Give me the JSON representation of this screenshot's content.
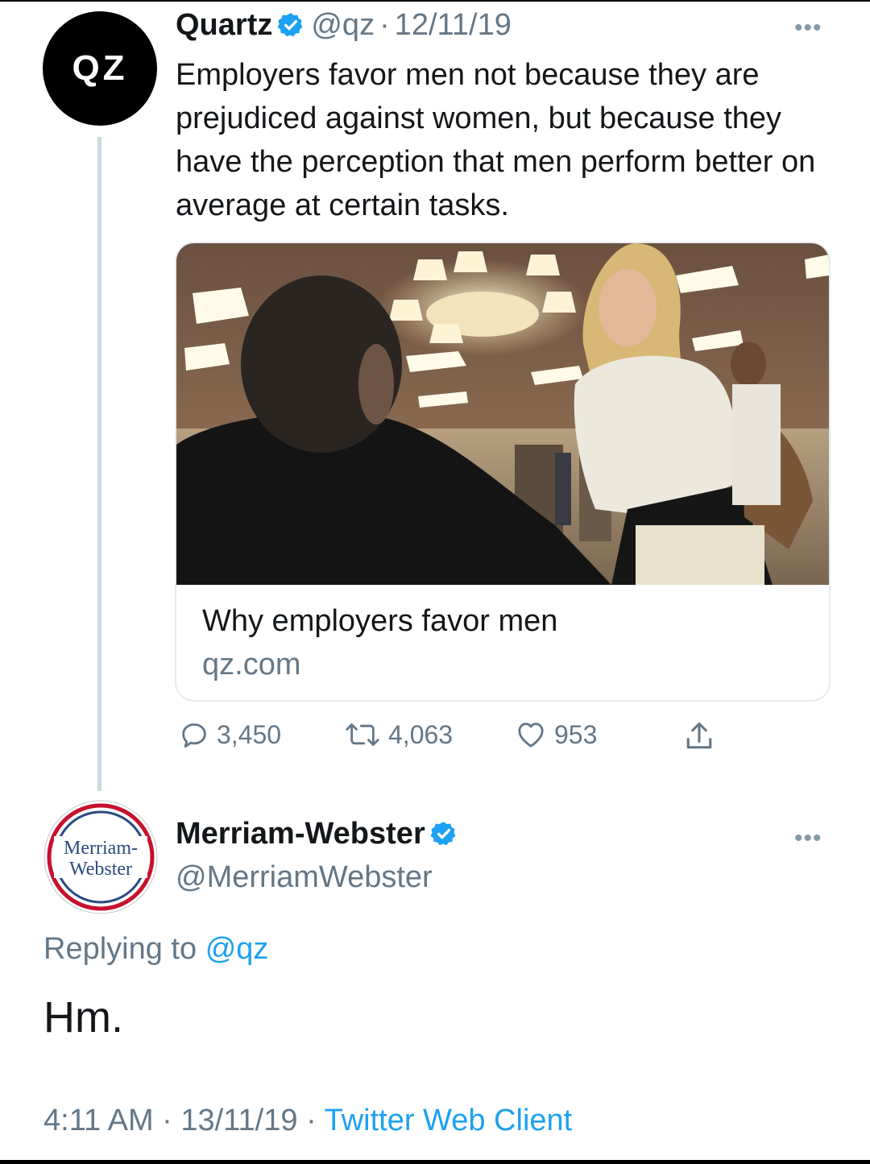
{
  "tweet": {
    "avatar_text": "QZ",
    "name": "Quartz",
    "handle": "@qz",
    "separator": "·",
    "date": "12/11/19",
    "more": "•••",
    "text": "Employers favor men not because they are prejudiced against women, but because they have the perception that men perform better on average at certain tasks.",
    "card": {
      "title": "Why employers favor men",
      "domain": "qz.com"
    },
    "actions": {
      "replies": "3,450",
      "retweets": "4,063",
      "likes": "953"
    }
  },
  "reply": {
    "avatar_line1": "Merriam-",
    "avatar_line2": "Webster",
    "name": "Merriam-Webster",
    "handle": "@MerriamWebster",
    "more": "•••",
    "replying_prefix": "Replying to",
    "replying_handle": "@qz",
    "text": "Hm.",
    "time": "4:11 AM",
    "separator": "·",
    "date": "13/11/19",
    "source": "Twitter Web Client"
  },
  "colors": {
    "accent": "#1da1f2",
    "secondary_text": "#657786",
    "primary_text": "#14171a",
    "mw_red": "#c8102e",
    "mw_blue": "#2a4a7f"
  }
}
